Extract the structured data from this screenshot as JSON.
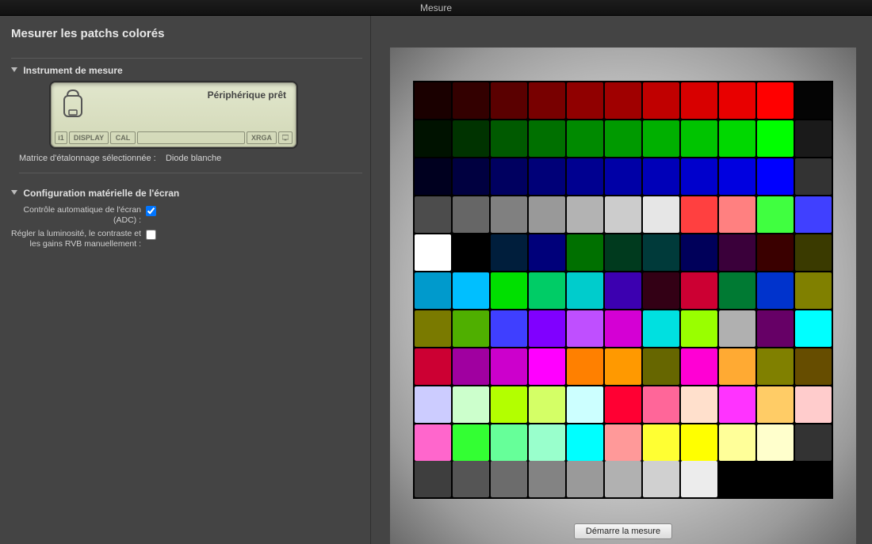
{
  "window": {
    "title": "Mesure"
  },
  "page": {
    "title": "Mesurer les patchs colorés"
  },
  "sections": {
    "instrument": {
      "title": "Instrument de mesure",
      "status": "Périphérique prêt",
      "slots": {
        "i1": "i1",
        "display": "DISPLAY",
        "cal": "CAL",
        "xrga": "XRGA"
      },
      "matrix_label": "Matrice d'étalonnage sélectionnée :",
      "matrix_value": "Diode blanche"
    },
    "hardware": {
      "title": "Configuration matérielle de l'écran",
      "adc_label": "Contrôle automatique de l'écran (ADC) :",
      "adc_checked": true,
      "manual_label": "Régler la luminosité, le contraste et les gains RVB manuellement :",
      "manual_checked": false
    }
  },
  "button": {
    "start": "Démarre la mesure"
  },
  "patches_full": [
    [
      "#1a0000",
      "#330000",
      "#5a0000",
      "#780000",
      "#900000",
      "#a00000",
      "#c00000",
      "#d80000",
      "#e80000",
      "#ff0000",
      "#040404"
    ],
    [
      "#001200",
      "#003300",
      "#005a00",
      "#007000",
      "#008a00",
      "#009a00",
      "#00b000",
      "#00c400",
      "#00d800",
      "#00ff00",
      "#1a1a1a"
    ],
    [
      "#00001f",
      "#000040",
      "#000060",
      "#000078",
      "#000090",
      "#0000a6",
      "#0000b8",
      "#0000cc",
      "#0000e0",
      "#0000ff",
      "#333333"
    ],
    [
      "#4c4c4c",
      "#666666",
      "#808080",
      "#999999",
      "#b3b3b3",
      "#cccccc",
      "#e6e6e6",
      "#ff4040",
      "#ff8080",
      "#40ff40",
      "#4040ff"
    ],
    [
      "#ffffff",
      "#000000",
      "#001e3c",
      "#00007a",
      "#007000",
      "#003a1e",
      "#003a3a",
      "#00005a",
      "#3a003a",
      "#3a0000",
      "#3a3a00"
    ],
    [
      "#009acc",
      "#00bfff",
      "#00e000",
      "#00cc66",
      "#00cccc",
      "#3c00b0",
      "#330015",
      "#cc0033",
      "#007a33",
      "#0033cc",
      "#808000"
    ],
    [
      "#7a7a00",
      "#4faf00",
      "#3f3fff",
      "#8000ff",
      "#bf4fff",
      "#d400d4",
      "#00e0e0",
      "#99ff00",
      "#b0b0b0",
      "#660066",
      "#00ffff"
    ],
    [
      "#cc0033",
      "#a000a0",
      "#cc00cc",
      "#ff00ff",
      "#ff8000",
      "#ff9900",
      "#666600",
      "#ff00d4",
      "#ffaa33",
      "#808000",
      "#664d00"
    ],
    [
      "#ccccff",
      "#ccffcc",
      "#b3ff00",
      "#d4ff66",
      "#ccffff",
      "#ff0033",
      "#ff6699",
      "#ffe0cc",
      "#ff33ff",
      "#ffcc66",
      "#ffcccc"
    ],
    [
      "#ff66cc",
      "#33ff33",
      "#66ff99",
      "#99ffcc",
      "#00ffff",
      "#ff9999",
      "#ffff33",
      "#ffff00",
      "#ffff99",
      "#ffffcc",
      "#333333"
    ]
  ],
  "patches_partial": [
    "#3e3e3e",
    "#555555",
    "#6c6c6c",
    "#838383",
    "#9a9a9a",
    "#b1b1b1",
    "#d0d0d0",
    "#ececec"
  ]
}
